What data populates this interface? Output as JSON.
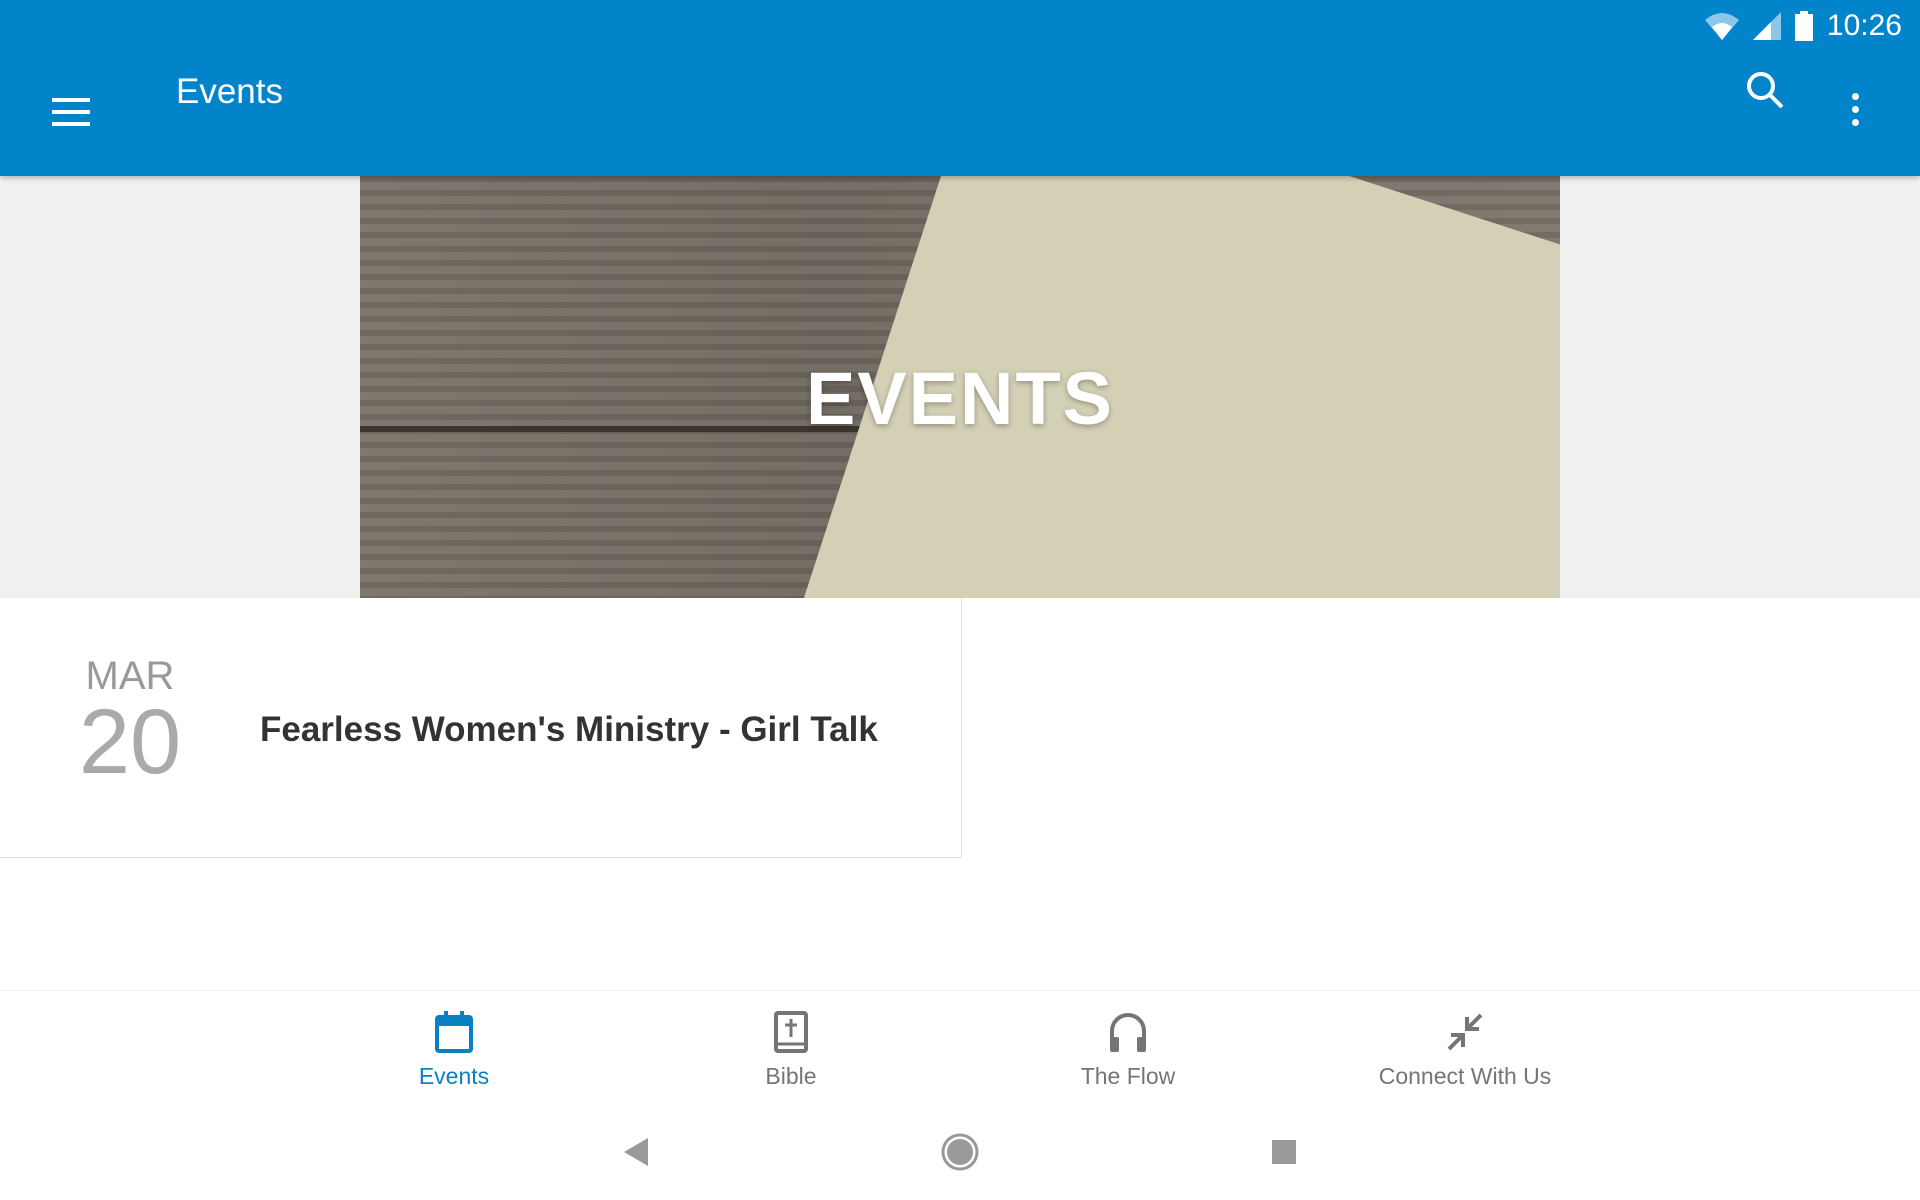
{
  "status_bar": {
    "time": "10:26",
    "icons": [
      "wifi-icon",
      "signal-icon",
      "battery-icon"
    ]
  },
  "app_bar": {
    "title": "Events",
    "icons": [
      "menu-icon",
      "search-icon",
      "more-vert-icon"
    ]
  },
  "banner": {
    "title": "EVENTS"
  },
  "events": [
    {
      "month": "MAR",
      "day": "20",
      "title": "Fearless Women's Ministry - Girl Talk"
    }
  ],
  "bottom_nav": {
    "active": 0,
    "tabs": [
      {
        "label": "Events",
        "icon": "calendar-icon"
      },
      {
        "label": "Bible",
        "icon": "bible-icon"
      },
      {
        "label": "The Flow",
        "icon": "headphones-icon"
      },
      {
        "label": "Connect With Us",
        "icon": "arrows-in-icon"
      }
    ]
  },
  "colors": {
    "primary": "#0284cb",
    "active_tab": "#0a7fc2"
  }
}
